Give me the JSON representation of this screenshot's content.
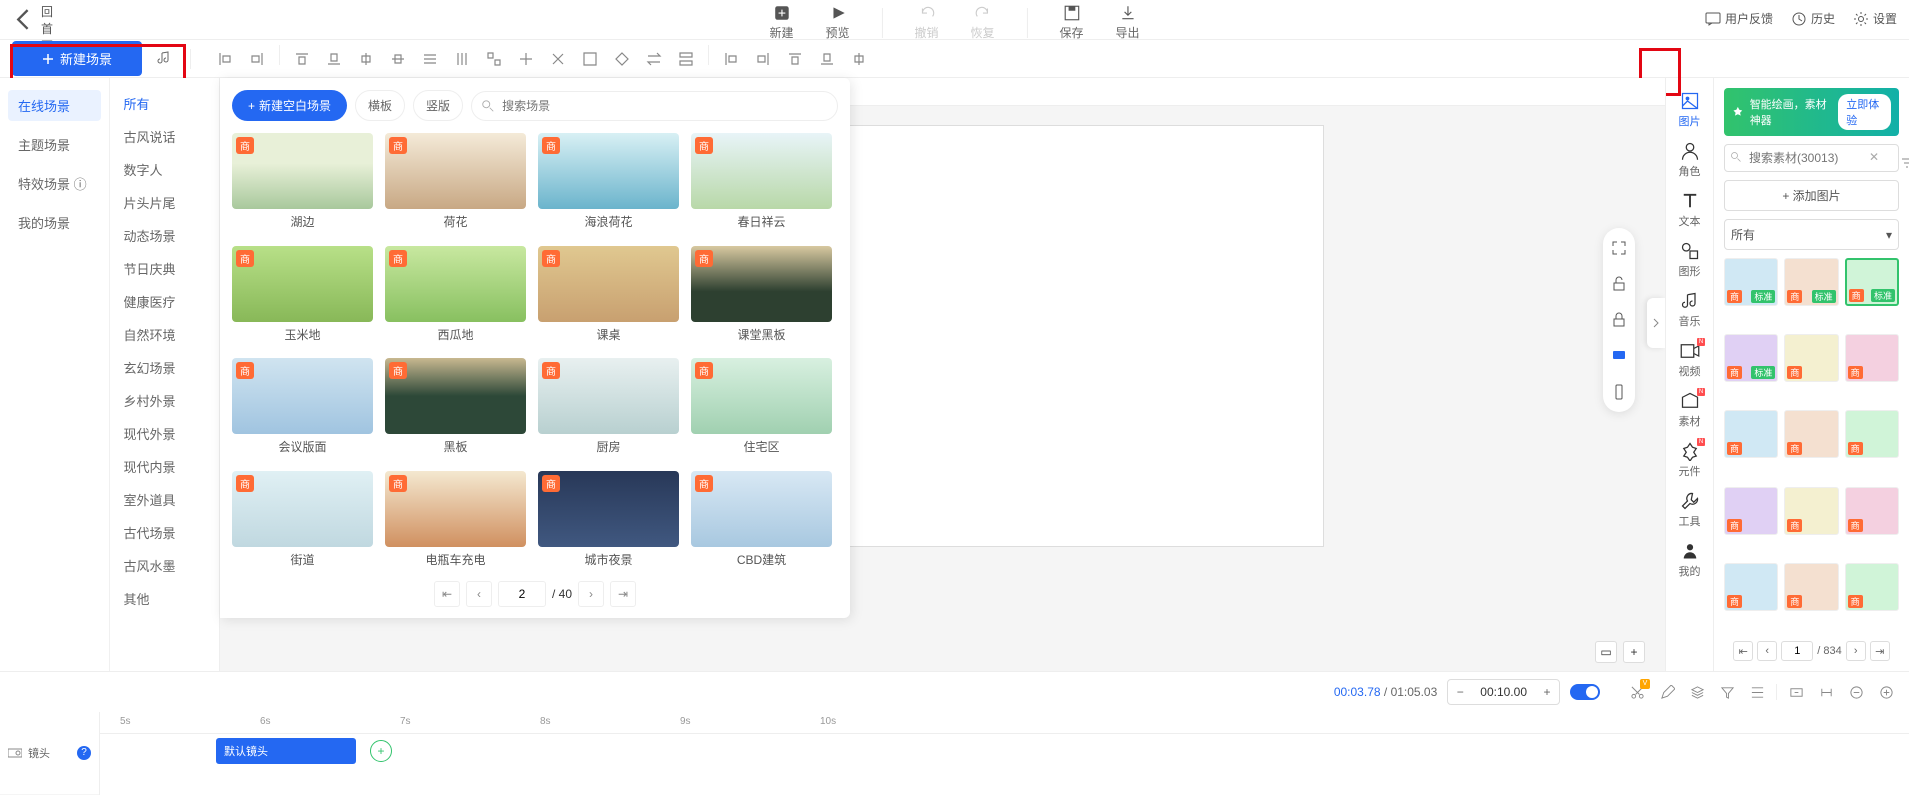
{
  "top": {
    "back": "返回首页",
    "center": [
      {
        "id": "new",
        "label": "新建"
      },
      {
        "id": "preview",
        "label": "预览"
      },
      {
        "id": "undo",
        "label": "撤销",
        "disabled": true
      },
      {
        "id": "redo",
        "label": "恢复",
        "disabled": true
      },
      {
        "id": "save",
        "label": "保存"
      },
      {
        "id": "export",
        "label": "导出"
      }
    ],
    "right": {
      "feedback": "用户反馈",
      "history": "历史",
      "settings": "设置"
    }
  },
  "newSceneBtn": "新建场景",
  "canvasTab": "默认镜头",
  "leftTabs": [
    {
      "label": "在线场景",
      "active": true
    },
    {
      "label": "主题场景"
    },
    {
      "label": "特效场景 ⓘ"
    },
    {
      "label": "我的场景"
    }
  ],
  "leftCats": [
    "所有",
    "古风说话",
    "数字人",
    "片头片尾",
    "动态场景",
    "节日庆典",
    "健康医疗",
    "自然环境",
    "玄幻场景",
    "乡村外景",
    "现代外景",
    "现代内景",
    "室外道具",
    "古代场景",
    "古风水墨",
    "其他"
  ],
  "scenePanel": {
    "newBlank": "新建空白场景",
    "filters": [
      "横板",
      "竖版"
    ],
    "searchPlaceholder": "搜索场景",
    "badge": "商",
    "items": [
      {
        "label": "湖边",
        "cls": "th-lake"
      },
      {
        "label": "荷花",
        "cls": "th-lotus"
      },
      {
        "label": "海浪荷花",
        "cls": "th-wave"
      },
      {
        "label": "春日祥云",
        "cls": "th-spring"
      },
      {
        "label": "玉米地",
        "cls": "th-corn"
      },
      {
        "label": "西瓜地",
        "cls": "th-melon"
      },
      {
        "label": "课桌",
        "cls": "th-desk"
      },
      {
        "label": "课堂黑板",
        "cls": "th-board"
      },
      {
        "label": "会议版面",
        "cls": "th-meeting"
      },
      {
        "label": "黑板",
        "cls": "th-black"
      },
      {
        "label": "厨房",
        "cls": "th-kitchen"
      },
      {
        "label": "住宅区",
        "cls": "th-res"
      },
      {
        "label": "街道",
        "cls": "th-street"
      },
      {
        "label": "电瓶车充电",
        "cls": "th-ebike"
      },
      {
        "label": "城市夜景",
        "cls": "th-night"
      },
      {
        "label": "CBD建筑",
        "cls": "th-cbd"
      }
    ],
    "page": "2",
    "total": "40"
  },
  "rightRail": [
    {
      "id": "image",
      "label": "图片",
      "active": true
    },
    {
      "id": "role",
      "label": "角色"
    },
    {
      "id": "text",
      "label": "文本"
    },
    {
      "id": "shape",
      "label": "图形"
    },
    {
      "id": "music",
      "label": "音乐"
    },
    {
      "id": "video",
      "label": "视频",
      "new": true
    },
    {
      "id": "asset",
      "label": "素材",
      "new": true
    },
    {
      "id": "component",
      "label": "元件",
      "new": true
    },
    {
      "id": "tool",
      "label": "工具"
    },
    {
      "id": "mine",
      "label": "我的"
    }
  ],
  "rightPanel": {
    "ai": {
      "text": "智能绘画，素材神器",
      "go": "立即体验"
    },
    "searchPlaceholder": "搜索素材(30013)",
    "add": "+ 添加图片",
    "filter": "所有",
    "cards": [
      {
        "tags": [
          "商",
          "标准"
        ]
      },
      {
        "tags": [
          "商",
          "标准"
        ]
      },
      {
        "tags": [
          "商",
          "标准"
        ],
        "sel": true
      },
      {
        "tags": [
          "商",
          "标准"
        ]
      },
      {
        "tags": [
          "商"
        ]
      },
      {
        "tags": [
          "商"
        ]
      },
      {
        "tags": [
          "商"
        ]
      },
      {
        "tags": [
          "商"
        ]
      },
      {
        "tags": [
          "商"
        ]
      },
      {
        "tags": [
          "商"
        ]
      },
      {
        "tags": [
          "商"
        ]
      },
      {
        "tags": [
          "商"
        ]
      },
      {
        "tags": [
          "商"
        ]
      },
      {
        "tags": [
          "商"
        ]
      },
      {
        "tags": [
          "商"
        ]
      }
    ],
    "page": "1",
    "total": "834"
  },
  "bottom": {
    "curTime": "00:03.78",
    "totalTime": "01:05.03",
    "zoomVal": "00:10.00",
    "ticks": [
      "5s",
      "6s",
      "7s",
      "8s",
      "9s",
      "10s"
    ],
    "trackLabel": "镜头",
    "clipLabel": "默认镜头"
  }
}
